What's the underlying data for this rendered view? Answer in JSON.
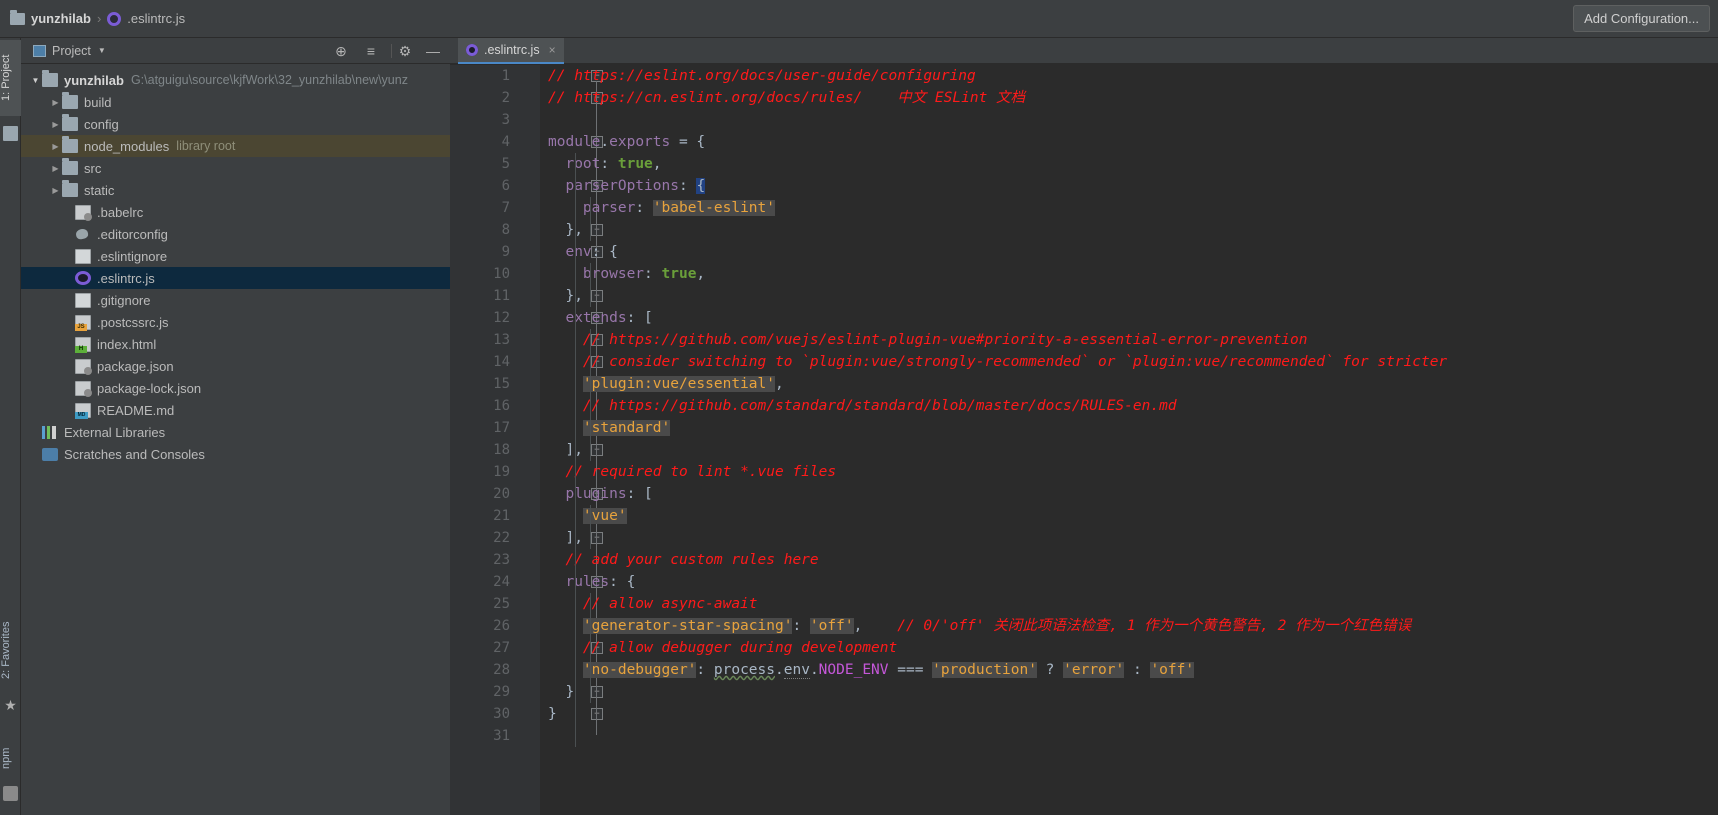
{
  "topbar": {
    "breadcrumb": {
      "project": "yunzhilab",
      "separator": "›",
      "file": ".eslintrc.js"
    },
    "add_configuration_label": "Add Configuration...",
    "accent_color": "#7b5cd6"
  },
  "left_strip": {
    "tabs": [
      {
        "label": "1: Project",
        "name": "vtab-project"
      },
      {
        "label": "2: Favorites",
        "name": "vtab-favorites"
      },
      {
        "label": "npm",
        "name": "vtab-npm"
      }
    ]
  },
  "project_panel": {
    "title": "Project",
    "caret": "▼",
    "buttons": {
      "locate": "⊕",
      "collapse_all": "≡",
      "settings": "⚙",
      "hide": "—"
    },
    "tree": [
      {
        "indent": 1,
        "arrow": "▼",
        "icon": "folder-icon",
        "label": "yunzhilab",
        "bold": true,
        "path": "G:\\atguigu\\source\\kjfWork\\32_yunzhilab\\new\\yunz",
        "hl": ""
      },
      {
        "indent": 2,
        "arrow": "▶",
        "icon": "folder-icon",
        "label": "build",
        "hl": ""
      },
      {
        "indent": 2,
        "arrow": "▶",
        "icon": "folder-icon",
        "label": "config",
        "hl": ""
      },
      {
        "indent": 2,
        "arrow": "▶",
        "icon": "folder-icon",
        "label": "node_modules",
        "hint": "library root",
        "hl": "hl-lib"
      },
      {
        "indent": 2,
        "arrow": "▶",
        "icon": "folder-icon",
        "label": "src",
        "hl": ""
      },
      {
        "indent": 2,
        "arrow": "▶",
        "icon": "folder-icon",
        "label": "static",
        "hl": ""
      },
      {
        "indent": 3,
        "arrow": "",
        "icon": "json-file-icon",
        "label": ".babelrc",
        "hl": ""
      },
      {
        "indent": 3,
        "arrow": "",
        "icon": "editorconfig-icon",
        "label": ".editorconfig",
        "hl": ""
      },
      {
        "indent": 3,
        "arrow": "",
        "icon": "text-file-icon",
        "label": ".eslintignore",
        "hl": ""
      },
      {
        "indent": 3,
        "arrow": "",
        "icon": "eslint-icon",
        "label": ".eslintrc.js",
        "hl": "hl-sel"
      },
      {
        "indent": 3,
        "arrow": "",
        "icon": "text-file-icon",
        "label": ".gitignore",
        "hl": ""
      },
      {
        "indent": 3,
        "arrow": "",
        "icon": "js-file-icon",
        "label": ".postcssrc.js",
        "hl": ""
      },
      {
        "indent": 3,
        "arrow": "",
        "icon": "html-file-icon",
        "label": "index.html",
        "hl": ""
      },
      {
        "indent": 3,
        "arrow": "",
        "icon": "json-file-icon",
        "label": "package.json",
        "hl": ""
      },
      {
        "indent": 3,
        "arrow": "",
        "icon": "json-file-icon",
        "label": "package-lock.json",
        "hl": ""
      },
      {
        "indent": 3,
        "arrow": "",
        "icon": "md-file-icon",
        "label": "README.md",
        "hl": ""
      },
      {
        "indent": 1,
        "arrow": "",
        "icon": "external-libraries-icon",
        "label": "External Libraries",
        "hl": ""
      },
      {
        "indent": 1,
        "arrow": "",
        "icon": "scratches-icon",
        "label": "Scratches and Consoles",
        "hl": ""
      }
    ]
  },
  "editor": {
    "tab": {
      "label": ".eslintrc.js",
      "close": "×"
    },
    "first_line": 1,
    "last_line": 31,
    "line_numbers": [
      1,
      2,
      3,
      4,
      5,
      6,
      7,
      8,
      9,
      10,
      11,
      12,
      13,
      14,
      15,
      16,
      17,
      18,
      19,
      20,
      21,
      22,
      23,
      24,
      25,
      26,
      27,
      28,
      29,
      30,
      31
    ],
    "code": [
      "// https://eslint.org/docs/user-guide/configuring",
      "// https://cn.eslint.org/docs/rules/    中文 ESLint 文档",
      "",
      "module.exports = {",
      "  root: true,",
      "  parserOptions: {",
      "    parser: 'babel-eslint'",
      "  },",
      "  env: {",
      "    browser: true,",
      "  },",
      "  extends: [",
      "    // https://github.com/vuejs/eslint-plugin-vue#priority-a-essential-error-prevention",
      "    // consider switching to `plugin:vue/strongly-recommended` or `plugin:vue/recommended` for stricter",
      "    'plugin:vue/essential',",
      "    // https://github.com/standard/standard/blob/master/docs/RULES-en.md",
      "    'standard'",
      "  ],",
      "  // required to lint *.vue files",
      "  plugins: [",
      "    'vue'",
      "  ],",
      "  // add your custom rules here",
      "  rules: {",
      "    // allow async-await",
      "    'generator-star-spacing': 'off',    // 0/'off' 关闭此项语法检查, 1 作为一个黄色警告, 2 作为一个红色错误",
      "    // allow debugger during development",
      "    'no-debugger': process.env.NODE_ENV === 'production' ? 'error' : 'off'",
      "  }",
      "}",
      ""
    ],
    "tokens": {
      "line1": [
        {
          "t": "// https://eslint.org/docs/user-guide/configuring",
          "c": "c-com"
        }
      ],
      "line2": [
        {
          "t": "// https://cn.eslint.org/docs/rules/    中文 ESLint 文档",
          "c": "c-com"
        }
      ],
      "line3": [],
      "line4": [
        {
          "t": "module",
          "c": "c-prop"
        },
        {
          "t": ".",
          "c": "c-plain"
        },
        {
          "t": "exports",
          "c": "c-prop"
        },
        {
          "t": " = {",
          "c": "c-plain"
        }
      ],
      "line5": [
        {
          "t": "  ",
          "c": "c-plain"
        },
        {
          "t": "root",
          "c": "c-prop"
        },
        {
          "t": ": ",
          "c": "c-plain"
        },
        {
          "t": "true",
          "c": "c-bool"
        },
        {
          "t": ",",
          "c": "c-plain"
        }
      ],
      "line6": [
        {
          "t": "  ",
          "c": "c-plain"
        },
        {
          "t": "parserOptions",
          "c": "c-prop"
        },
        {
          "t": ": ",
          "c": "c-plain"
        },
        {
          "t": "{",
          "c": "c-sel"
        }
      ],
      "line7": [
        {
          "t": "    ",
          "c": "c-plain"
        },
        {
          "t": "parser",
          "c": "c-prop"
        },
        {
          "t": ": ",
          "c": "c-plain"
        },
        {
          "t": "'babel-eslint'",
          "c": "c-str"
        }
      ],
      "line8": [
        {
          "t": "  },",
          "c": "c-plain"
        }
      ],
      "line9": [
        {
          "t": "  ",
          "c": "c-plain"
        },
        {
          "t": "env",
          "c": "c-prop"
        },
        {
          "t": ": {",
          "c": "c-plain"
        }
      ],
      "line10": [
        {
          "t": "    ",
          "c": "c-plain"
        },
        {
          "t": "browser",
          "c": "c-prop"
        },
        {
          "t": ": ",
          "c": "c-plain"
        },
        {
          "t": "true",
          "c": "c-bool"
        },
        {
          "t": ",",
          "c": "c-plain"
        }
      ],
      "line11": [
        {
          "t": "  },",
          "c": "c-plain"
        }
      ],
      "line12": [
        {
          "t": "  ",
          "c": "c-plain"
        },
        {
          "t": "extends",
          "c": "c-prop"
        },
        {
          "t": ": [",
          "c": "c-plain"
        }
      ],
      "line13": [
        {
          "t": "    ",
          "c": "c-plain"
        },
        {
          "t": "// https://github.com/vuejs/eslint-plugin-vue#priority-a-essential-error-prevention",
          "c": "c-com"
        }
      ],
      "line14": [
        {
          "t": "    ",
          "c": "c-plain"
        },
        {
          "t": "// consider switching to `plugin:vue/strongly-recommended` or `plugin:vue/recommended` for stricter",
          "c": "c-com"
        }
      ],
      "line15": [
        {
          "t": "    ",
          "c": "c-plain"
        },
        {
          "t": "'plugin:vue/essential'",
          "c": "c-str"
        },
        {
          "t": ",",
          "c": "c-plain"
        }
      ],
      "line16": [
        {
          "t": "    ",
          "c": "c-plain"
        },
        {
          "t": "// https://github.com/standard/standard/blob/master/docs/RULES-en.md",
          "c": "c-com"
        }
      ],
      "line17": [
        {
          "t": "    ",
          "c": "c-plain"
        },
        {
          "t": "'standard'",
          "c": "c-str"
        }
      ],
      "line18": [
        {
          "t": "  ],",
          "c": "c-plain"
        }
      ],
      "line19": [
        {
          "t": "  ",
          "c": "c-plain"
        },
        {
          "t": "// required to lint *.vue files",
          "c": "c-com"
        }
      ],
      "line20": [
        {
          "t": "  ",
          "c": "c-plain"
        },
        {
          "t": "plugins",
          "c": "c-prop"
        },
        {
          "t": ": [",
          "c": "c-plain"
        }
      ],
      "line21": [
        {
          "t": "    ",
          "c": "c-plain"
        },
        {
          "t": "'vue'",
          "c": "c-str"
        }
      ],
      "line22": [
        {
          "t": "  ],",
          "c": "c-plain"
        }
      ],
      "line23": [
        {
          "t": "  ",
          "c": "c-plain"
        },
        {
          "t": "// add your custom rules here",
          "c": "c-com"
        }
      ],
      "line24": [
        {
          "t": "  ",
          "c": "c-plain"
        },
        {
          "t": "rules",
          "c": "c-prop"
        },
        {
          "t": ": {",
          "c": "c-plain"
        }
      ],
      "line25": [
        {
          "t": "    ",
          "c": "c-plain"
        },
        {
          "t": "// allow async-await",
          "c": "c-com"
        }
      ],
      "line26": [
        {
          "t": "    ",
          "c": "c-plain"
        },
        {
          "t": "'generator-star-spacing'",
          "c": "c-str"
        },
        {
          "t": ": ",
          "c": "c-plain"
        },
        {
          "t": "'off'",
          "c": "c-str"
        },
        {
          "t": ",",
          "c": "c-plain"
        },
        {
          "t": "    ",
          "c": "c-plain"
        },
        {
          "t": "// 0/'off' 关闭此项语法检查, 1 作为一个黄色警告, 2 作为一个红色错误",
          "c": "c-com"
        }
      ],
      "line27": [
        {
          "t": "    ",
          "c": "c-plain"
        },
        {
          "t": "// allow debugger during development",
          "c": "c-com"
        }
      ],
      "line28": [
        {
          "t": "    ",
          "c": "c-plain"
        },
        {
          "t": "'no-debugger'",
          "c": "c-str"
        },
        {
          "t": ": ",
          "c": "c-plain"
        },
        {
          "t": "process",
          "c": "c-wavy"
        },
        {
          "t": ".",
          "c": "c-plain"
        },
        {
          "t": "env",
          "c": "c-warn"
        },
        {
          "t": ".",
          "c": "c-plain"
        },
        {
          "t": "NODE_ENV",
          "c": "c-const"
        },
        {
          "t": " === ",
          "c": "c-plain"
        },
        {
          "t": "'production'",
          "c": "c-str"
        },
        {
          "t": " ? ",
          "c": "c-plain"
        },
        {
          "t": "'error'",
          "c": "c-str"
        },
        {
          "t": " : ",
          "c": "c-plain"
        },
        {
          "t": "'off'",
          "c": "c-str"
        }
      ],
      "line29": [
        {
          "t": "  }",
          "c": "c-plain"
        }
      ],
      "line30": [
        {
          "t": "}",
          "c": "c-plain"
        }
      ],
      "line31": []
    },
    "folds": [
      {
        "line": 1,
        "glyph": "−"
      },
      {
        "line": 2,
        "glyph": "−"
      },
      {
        "line": 4,
        "glyph": "−"
      },
      {
        "line": 6,
        "glyph": "−"
      },
      {
        "line": 8,
        "glyph": "−"
      },
      {
        "line": 9,
        "glyph": "−"
      },
      {
        "line": 11,
        "glyph": "−"
      },
      {
        "line": 12,
        "glyph": "−"
      },
      {
        "line": 13,
        "glyph": "−"
      },
      {
        "line": 14,
        "glyph": "−"
      },
      {
        "line": 18,
        "glyph": "−"
      },
      {
        "line": 20,
        "glyph": "−"
      },
      {
        "line": 22,
        "glyph": "−"
      },
      {
        "line": 24,
        "glyph": "−"
      },
      {
        "line": 26,
        "glyph": "−"
      },
      {
        "line": 27,
        "glyph": "−"
      },
      {
        "line": 29,
        "glyph": "−"
      },
      {
        "line": 30,
        "glyph": "−"
      }
    ],
    "colors": {
      "background": "#2b2b2b",
      "gutter": "#313335",
      "comment": "#ff1a1a",
      "string": "#e8a33d",
      "property": "#9876aa",
      "boolean": "#6a9f3a",
      "constant": "#c457d8",
      "plain": "#a9b7c6",
      "selection": "#214283"
    }
  }
}
